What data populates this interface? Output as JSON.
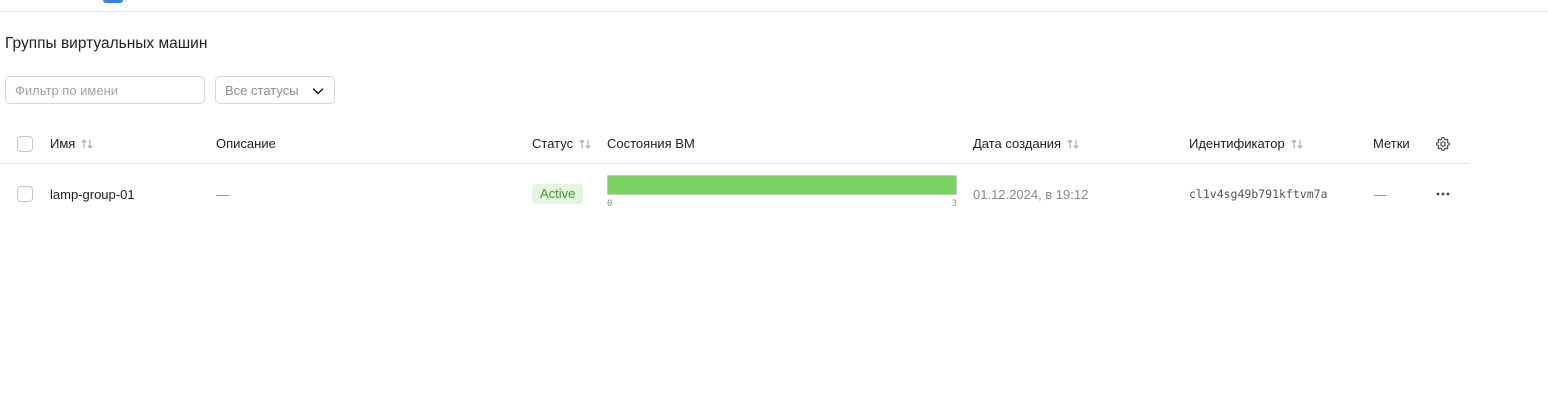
{
  "page": {
    "title": "Группы виртуальных машин"
  },
  "filters": {
    "name_placeholder": "Фильтр по имени",
    "status_select_value": "Все статусы"
  },
  "table": {
    "columns": {
      "name": "Имя",
      "description": "Описание",
      "status": "Статус",
      "vm_states": "Состояния ВМ",
      "created": "Дата создания",
      "id": "Идентификатор",
      "labels": "Метки"
    },
    "rows": [
      {
        "name": "lamp-group-01",
        "description": "—",
        "status": "Active",
        "vm_states": {
          "min": "0",
          "max": "3",
          "running": 3,
          "total": 3
        },
        "created": "01.12.2024, в 19:12",
        "id": "cl1v4sg49b791kftvm7a",
        "labels": "—"
      }
    ]
  },
  "colors": {
    "accent": "#3f7de8",
    "status_active_bg": "#e4f4e0",
    "status_active_text": "#3d9a2a",
    "vm_running": "#7bd35f"
  },
  "icons": {
    "sort": "sort-arrows-icon",
    "settings": "gear-icon",
    "row_menu": "more-horizontal-icon",
    "select_chevron": "chevron-down-icon"
  }
}
